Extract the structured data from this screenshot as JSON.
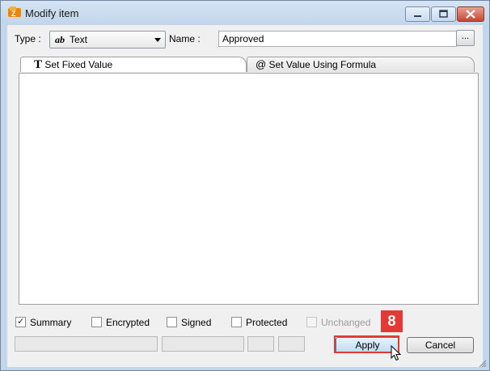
{
  "window": {
    "title": "Modify item"
  },
  "type_field": {
    "label": "Type :",
    "icon_text": "ab",
    "value": "Text"
  },
  "name_field": {
    "label": "Name :",
    "value": "Approved"
  },
  "browse_button": {
    "label": "..."
  },
  "tabs": [
    {
      "icon_text": "T",
      "label": "Set Fixed Value",
      "active": true
    },
    {
      "icon_text": "@",
      "label": "Set Value Using Formula",
      "active": false
    }
  ],
  "options": [
    {
      "label": "Summary",
      "checked": true,
      "disabled": false
    },
    {
      "label": "Encrypted",
      "checked": false,
      "disabled": false
    },
    {
      "label": "Signed",
      "checked": false,
      "disabled": false
    },
    {
      "label": "Protected",
      "checked": false,
      "disabled": false
    },
    {
      "label": "Unchanged",
      "checked": false,
      "disabled": true
    }
  ],
  "buttons": {
    "apply": "Apply",
    "cancel": "Cancel"
  },
  "step_badge": "8",
  "colors": {
    "highlight": "#e53935",
    "titlebar": "#c4d6ea",
    "close_button": "#c74634"
  }
}
